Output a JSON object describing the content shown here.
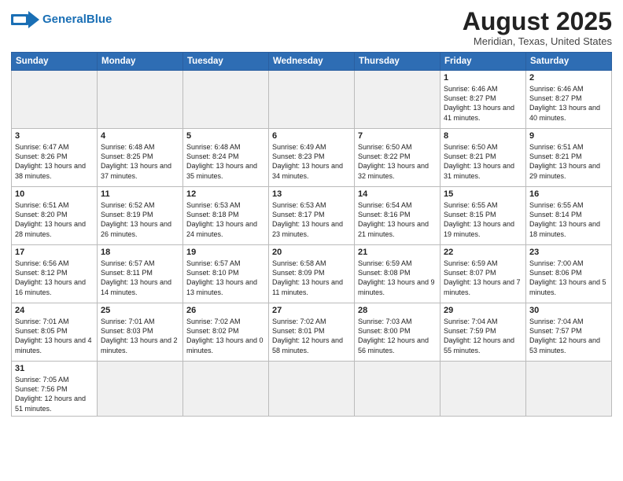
{
  "logo": {
    "text_general": "General",
    "text_blue": "Blue"
  },
  "title": "August 2025",
  "subtitle": "Meridian, Texas, United States",
  "days_header": [
    "Sunday",
    "Monday",
    "Tuesday",
    "Wednesday",
    "Thursday",
    "Friday",
    "Saturday"
  ],
  "weeks": [
    [
      {
        "day": "",
        "info": ""
      },
      {
        "day": "",
        "info": ""
      },
      {
        "day": "",
        "info": ""
      },
      {
        "day": "",
        "info": ""
      },
      {
        "day": "",
        "info": ""
      },
      {
        "day": "1",
        "info": "Sunrise: 6:46 AM\nSunset: 8:27 PM\nDaylight: 13 hours and 41 minutes."
      },
      {
        "day": "2",
        "info": "Sunrise: 6:46 AM\nSunset: 8:27 PM\nDaylight: 13 hours and 40 minutes."
      }
    ],
    [
      {
        "day": "3",
        "info": "Sunrise: 6:47 AM\nSunset: 8:26 PM\nDaylight: 13 hours and 38 minutes."
      },
      {
        "day": "4",
        "info": "Sunrise: 6:48 AM\nSunset: 8:25 PM\nDaylight: 13 hours and 37 minutes."
      },
      {
        "day": "5",
        "info": "Sunrise: 6:48 AM\nSunset: 8:24 PM\nDaylight: 13 hours and 35 minutes."
      },
      {
        "day": "6",
        "info": "Sunrise: 6:49 AM\nSunset: 8:23 PM\nDaylight: 13 hours and 34 minutes."
      },
      {
        "day": "7",
        "info": "Sunrise: 6:50 AM\nSunset: 8:22 PM\nDaylight: 13 hours and 32 minutes."
      },
      {
        "day": "8",
        "info": "Sunrise: 6:50 AM\nSunset: 8:21 PM\nDaylight: 13 hours and 31 minutes."
      },
      {
        "day": "9",
        "info": "Sunrise: 6:51 AM\nSunset: 8:21 PM\nDaylight: 13 hours and 29 minutes."
      }
    ],
    [
      {
        "day": "10",
        "info": "Sunrise: 6:51 AM\nSunset: 8:20 PM\nDaylight: 13 hours and 28 minutes."
      },
      {
        "day": "11",
        "info": "Sunrise: 6:52 AM\nSunset: 8:19 PM\nDaylight: 13 hours and 26 minutes."
      },
      {
        "day": "12",
        "info": "Sunrise: 6:53 AM\nSunset: 8:18 PM\nDaylight: 13 hours and 24 minutes."
      },
      {
        "day": "13",
        "info": "Sunrise: 6:53 AM\nSunset: 8:17 PM\nDaylight: 13 hours and 23 minutes."
      },
      {
        "day": "14",
        "info": "Sunrise: 6:54 AM\nSunset: 8:16 PM\nDaylight: 13 hours and 21 minutes."
      },
      {
        "day": "15",
        "info": "Sunrise: 6:55 AM\nSunset: 8:15 PM\nDaylight: 13 hours and 19 minutes."
      },
      {
        "day": "16",
        "info": "Sunrise: 6:55 AM\nSunset: 8:14 PM\nDaylight: 13 hours and 18 minutes."
      }
    ],
    [
      {
        "day": "17",
        "info": "Sunrise: 6:56 AM\nSunset: 8:12 PM\nDaylight: 13 hours and 16 minutes."
      },
      {
        "day": "18",
        "info": "Sunrise: 6:57 AM\nSunset: 8:11 PM\nDaylight: 13 hours and 14 minutes."
      },
      {
        "day": "19",
        "info": "Sunrise: 6:57 AM\nSunset: 8:10 PM\nDaylight: 13 hours and 13 minutes."
      },
      {
        "day": "20",
        "info": "Sunrise: 6:58 AM\nSunset: 8:09 PM\nDaylight: 13 hours and 11 minutes."
      },
      {
        "day": "21",
        "info": "Sunrise: 6:59 AM\nSunset: 8:08 PM\nDaylight: 13 hours and 9 minutes."
      },
      {
        "day": "22",
        "info": "Sunrise: 6:59 AM\nSunset: 8:07 PM\nDaylight: 13 hours and 7 minutes."
      },
      {
        "day": "23",
        "info": "Sunrise: 7:00 AM\nSunset: 8:06 PM\nDaylight: 13 hours and 5 minutes."
      }
    ],
    [
      {
        "day": "24",
        "info": "Sunrise: 7:01 AM\nSunset: 8:05 PM\nDaylight: 13 hours and 4 minutes."
      },
      {
        "day": "25",
        "info": "Sunrise: 7:01 AM\nSunset: 8:03 PM\nDaylight: 13 hours and 2 minutes."
      },
      {
        "day": "26",
        "info": "Sunrise: 7:02 AM\nSunset: 8:02 PM\nDaylight: 13 hours and 0 minutes."
      },
      {
        "day": "27",
        "info": "Sunrise: 7:02 AM\nSunset: 8:01 PM\nDaylight: 12 hours and 58 minutes."
      },
      {
        "day": "28",
        "info": "Sunrise: 7:03 AM\nSunset: 8:00 PM\nDaylight: 12 hours and 56 minutes."
      },
      {
        "day": "29",
        "info": "Sunrise: 7:04 AM\nSunset: 7:59 PM\nDaylight: 12 hours and 55 minutes."
      },
      {
        "day": "30",
        "info": "Sunrise: 7:04 AM\nSunset: 7:57 PM\nDaylight: 12 hours and 53 minutes."
      }
    ],
    [
      {
        "day": "31",
        "info": "Sunrise: 7:05 AM\nSunset: 7:56 PM\nDaylight: 12 hours and 51 minutes."
      },
      {
        "day": "",
        "info": ""
      },
      {
        "day": "",
        "info": ""
      },
      {
        "day": "",
        "info": ""
      },
      {
        "day": "",
        "info": ""
      },
      {
        "day": "",
        "info": ""
      },
      {
        "day": "",
        "info": ""
      }
    ]
  ]
}
